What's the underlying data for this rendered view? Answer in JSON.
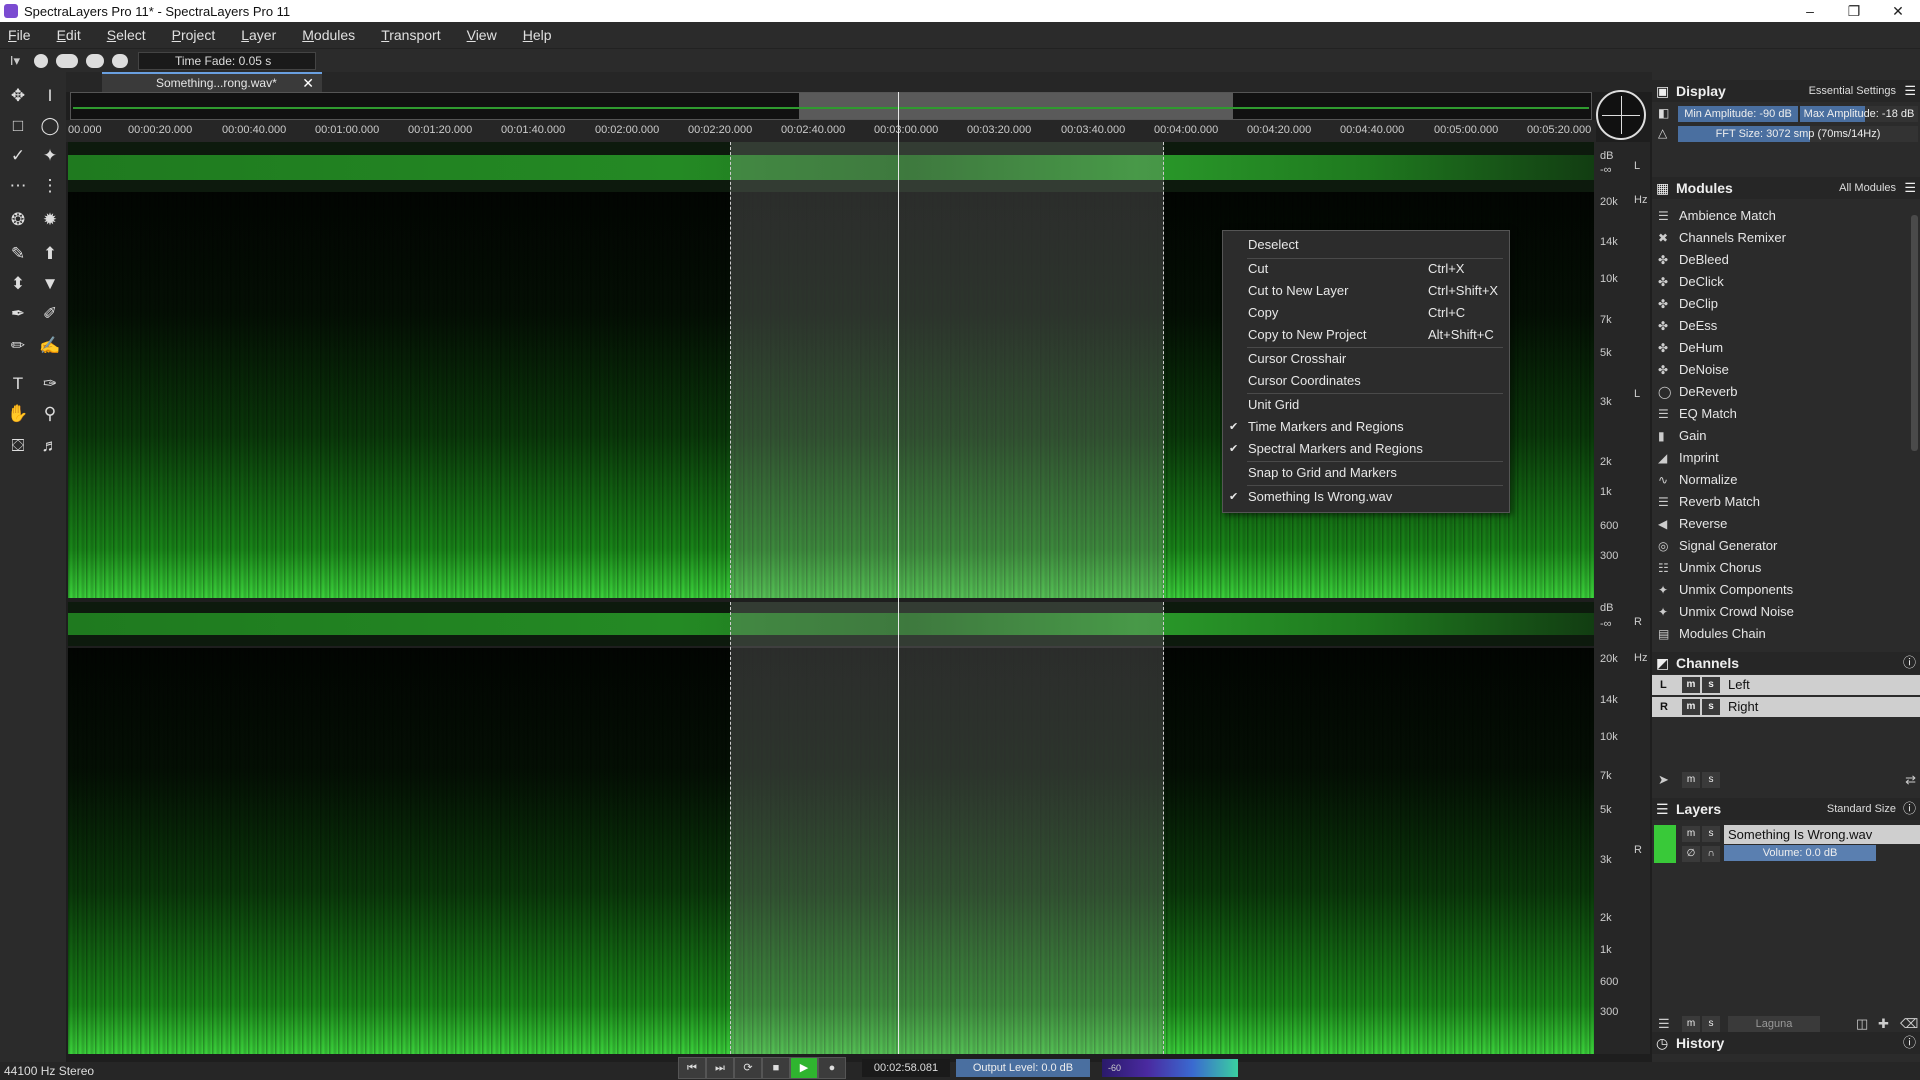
{
  "window": {
    "title": "SpectraLayers Pro 11* - SpectraLayers Pro 11"
  },
  "menu": [
    "File",
    "Edit",
    "Select",
    "Project",
    "Layer",
    "Modules",
    "Transport",
    "View",
    "Help"
  ],
  "options": {
    "time_fade": "Time Fade: 0.05 s"
  },
  "tab": {
    "label": "Something...rong.wav*"
  },
  "ruler": [
    "00.000",
    "00:00:20.000",
    "00:00:40.000",
    "00:01:00.000",
    "00:01:20.000",
    "00:01:40.000",
    "00:02:00.000",
    "00:02:20.000",
    "00:02:40.000",
    "00:03:00.000",
    "00:03:20.000",
    "00:03:40.000",
    "00:04:00.000",
    "00:04:20.000",
    "00:04:40.000",
    "00:05:00.000",
    "00:05:20.000"
  ],
  "scale": {
    "db": "dB",
    "hz": "Hz",
    "minus_inf": "-∞",
    "left": "L",
    "right": "R",
    "freq": [
      "20k",
      "14k",
      "10k",
      "7k",
      "5k",
      "3k",
      "2k",
      "1k",
      "600",
      "300"
    ]
  },
  "context_menu": {
    "items": [
      {
        "label": "Deselect",
        "shortcut": "",
        "checked": false
      },
      {
        "label": "Cut",
        "shortcut": "Ctrl+X",
        "checked": false
      },
      {
        "label": "Cut to New Layer",
        "shortcut": "Ctrl+Shift+X",
        "checked": false
      },
      {
        "label": "Copy",
        "shortcut": "Ctrl+C",
        "checked": false
      },
      {
        "label": "Copy to New Project",
        "shortcut": "Alt+Shift+C",
        "checked": false
      },
      {
        "label": "Cursor Crosshair",
        "shortcut": "",
        "checked": false
      },
      {
        "label": "Cursor Coordinates",
        "shortcut": "",
        "checked": false
      },
      {
        "label": "Unit Grid",
        "shortcut": "",
        "checked": false
      },
      {
        "label": "Time Markers and Regions",
        "shortcut": "",
        "checked": true
      },
      {
        "label": "Spectral Markers and Regions",
        "shortcut": "",
        "checked": true
      },
      {
        "label": "Snap to Grid and Markers",
        "shortcut": "",
        "checked": false
      },
      {
        "label": "Something Is Wrong.wav",
        "shortcut": "",
        "checked": true
      }
    ]
  },
  "display": {
    "title": "Display",
    "preset": "Essential Settings",
    "min_amp": "Min Amplitude: -90 dB",
    "max_amp": "Max Amplitude: -18 dB",
    "fft": "FFT Size: 3072 smp (70ms/14Hz)"
  },
  "modules": {
    "title": "Modules",
    "filter": "All Modules",
    "items": [
      "Ambience Match",
      "Channels Remixer",
      "DeBleed",
      "DeClick",
      "DeClip",
      "DeEss",
      "DeHum",
      "DeNoise",
      "DeReverb",
      "EQ Match",
      "Gain",
      "Imprint",
      "Normalize",
      "Reverb Match",
      "Reverse",
      "Signal Generator",
      "Unmix Chorus",
      "Unmix Components",
      "Unmix Crowd Noise",
      "Modules Chain"
    ]
  },
  "channels": {
    "title": "Channels",
    "items": [
      {
        "letter": "L",
        "name": "Left"
      },
      {
        "letter": "R",
        "name": "Right"
      }
    ],
    "m": "m",
    "s": "s"
  },
  "layers": {
    "title": "Layers",
    "size": "Standard Size",
    "name": "Something Is Wrong.wav",
    "volume": "Volume: 0.0 dB",
    "blend": "Laguna"
  },
  "history": {
    "title": "History"
  },
  "status": {
    "format": "44100 Hz Stereo",
    "timecode": "00:02:58.081",
    "output": "Output Level: 0.0 dB",
    "meter": "-60"
  }
}
